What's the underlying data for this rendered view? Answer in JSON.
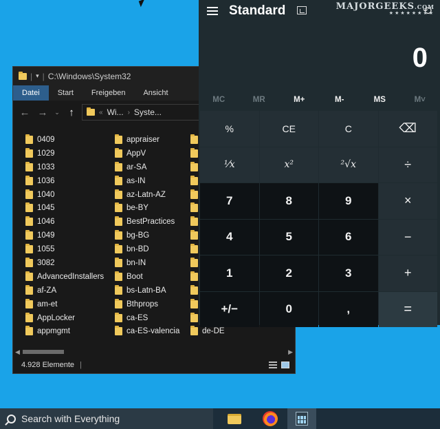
{
  "explorer": {
    "path": "C:\\Windows\\System32",
    "ribbon_tabs": [
      "Datei",
      "Start",
      "Freigeben",
      "Ansicht"
    ],
    "address": {
      "part1": "Wi...",
      "part2": "Syste..."
    },
    "columns": [
      [
        "0409",
        "1029",
        "1033",
        "1036",
        "1040",
        "1045",
        "1046",
        "1049",
        "1055",
        "3082",
        "AdvancedInstallers",
        "af-ZA",
        "am-et",
        "AppLocker",
        "appmgmt"
      ],
      [
        "appraiser",
        "AppV",
        "ar-SA",
        "as-IN",
        "az-Latn-AZ",
        "be-BY",
        "BestPractices",
        "bg-BG",
        "bn-BD",
        "bn-IN",
        "Boot",
        "bs-Latn-BA",
        "Bthprops",
        "ca-ES",
        "ca-ES-valencia"
      ],
      [
        "",
        "",
        "",
        "",
        "",
        "",
        "",
        "",
        "",
        "",
        "",
        "",
        "",
        "",
        "de-DE"
      ]
    ],
    "status": "4.928 Elemente"
  },
  "calculator": {
    "title": "Standard",
    "display": "0",
    "memory": [
      "MC",
      "MR",
      "M+",
      "M-",
      "MS",
      "M˅"
    ],
    "keys": [
      [
        "%",
        "CE",
        "C",
        "⌫"
      ],
      [
        "¹⁄x",
        "x²",
        "²√x",
        "÷"
      ],
      [
        "7",
        "8",
        "9",
        "×"
      ],
      [
        "4",
        "5",
        "6",
        "−"
      ],
      [
        "1",
        "2",
        "3",
        "+"
      ],
      [
        "+/−",
        "0",
        ",",
        "="
      ]
    ]
  },
  "watermark": {
    "brand": "MAJORGEEKS",
    "suffix": ".COM",
    "stars": "★★★★★★★★"
  },
  "taskbar": {
    "search_text": "Search with Everything"
  }
}
